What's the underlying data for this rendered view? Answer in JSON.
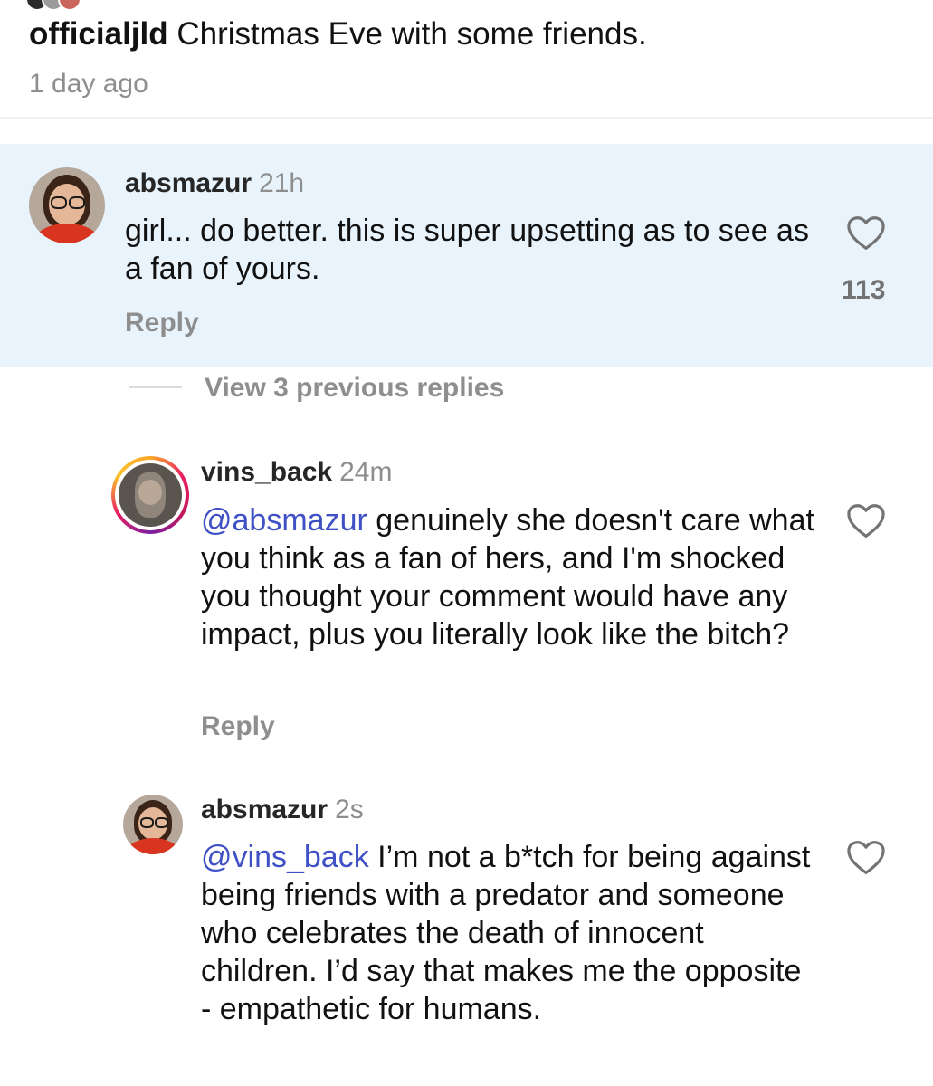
{
  "caption": {
    "username": "officialjld",
    "text": "Christmas Eve with some friends.",
    "time": "1 day ago"
  },
  "comments": [
    {
      "username": "absmazur",
      "time": "21h",
      "text": "girl... do better. this is super upsetting as to see as a fan of yours.",
      "likes": "113",
      "reply_label": "Reply"
    }
  ],
  "view_replies": "View 3 previous replies",
  "replies": [
    {
      "username": "vins_back",
      "time": "24m",
      "mention": "@absmazur",
      "text": "genuinely she doesn't care what you think as a fan of hers, and I'm shocked you thought your comment would have any impact, plus you literally look like the bitch?",
      "reply_label": "Reply"
    },
    {
      "username": "absmazur",
      "time": "2s",
      "mention": "@vins_back",
      "text": "I’m not a b*tch for being against being friends with a predator and someone who celebrates the death of innocent children. I’d say that makes me the opposite - empathetic for humans."
    }
  ],
  "colors": {
    "highlight_bg": "#e8f3fc",
    "mention": "#3f51c4",
    "muted": "#8e8e8e"
  },
  "icons": [
    "heart-icon",
    "avatar"
  ]
}
